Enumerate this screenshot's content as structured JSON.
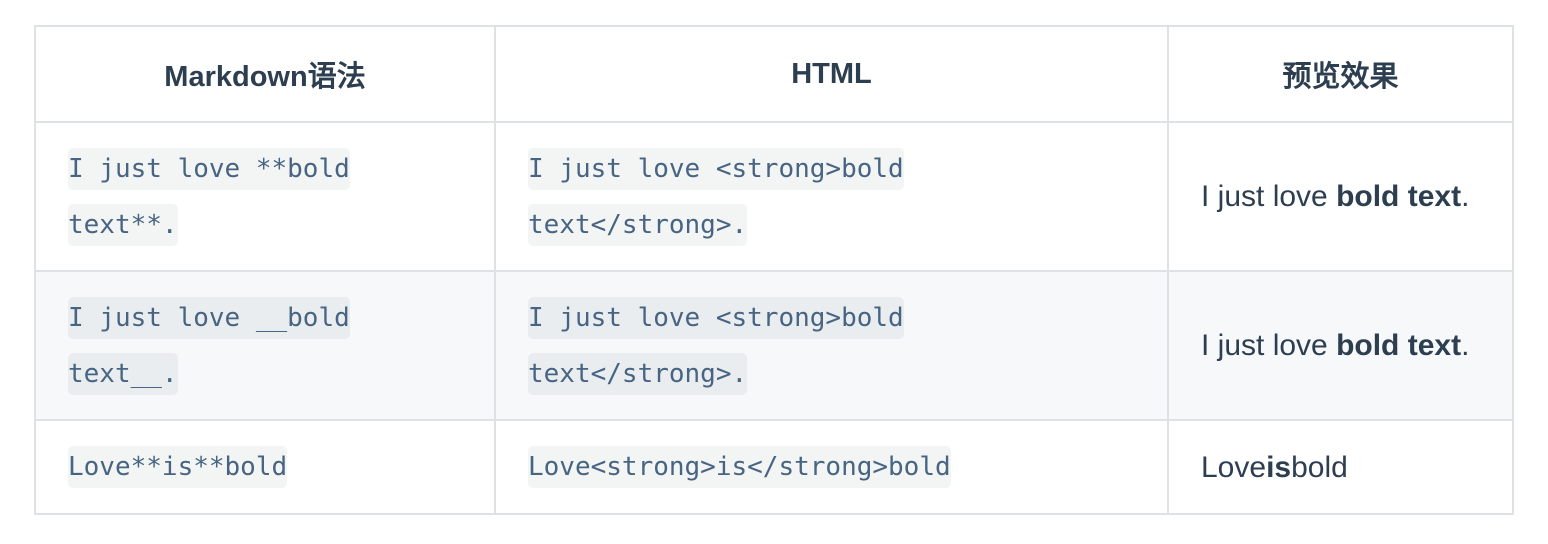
{
  "table": {
    "headers": [
      "Markdown语法",
      "HTML",
      "预览效果"
    ],
    "rows": [
      {
        "markdown": "I just love **bold text**.",
        "html": "I just love <strong>bold text</strong>.",
        "preview": {
          "before": "I just love ",
          "bold": "bold text",
          "after": "."
        }
      },
      {
        "markdown": "I just love __bold text__.",
        "html": "I just love <strong>bold text</strong>.",
        "preview": {
          "before": "I just love ",
          "bold": "bold text",
          "after": "."
        }
      },
      {
        "markdown": "Love**is**bold",
        "html": "Love<strong>is</strong>bold",
        "preview": {
          "before": "Love",
          "bold": "is",
          "after": "bold"
        }
      }
    ]
  }
}
